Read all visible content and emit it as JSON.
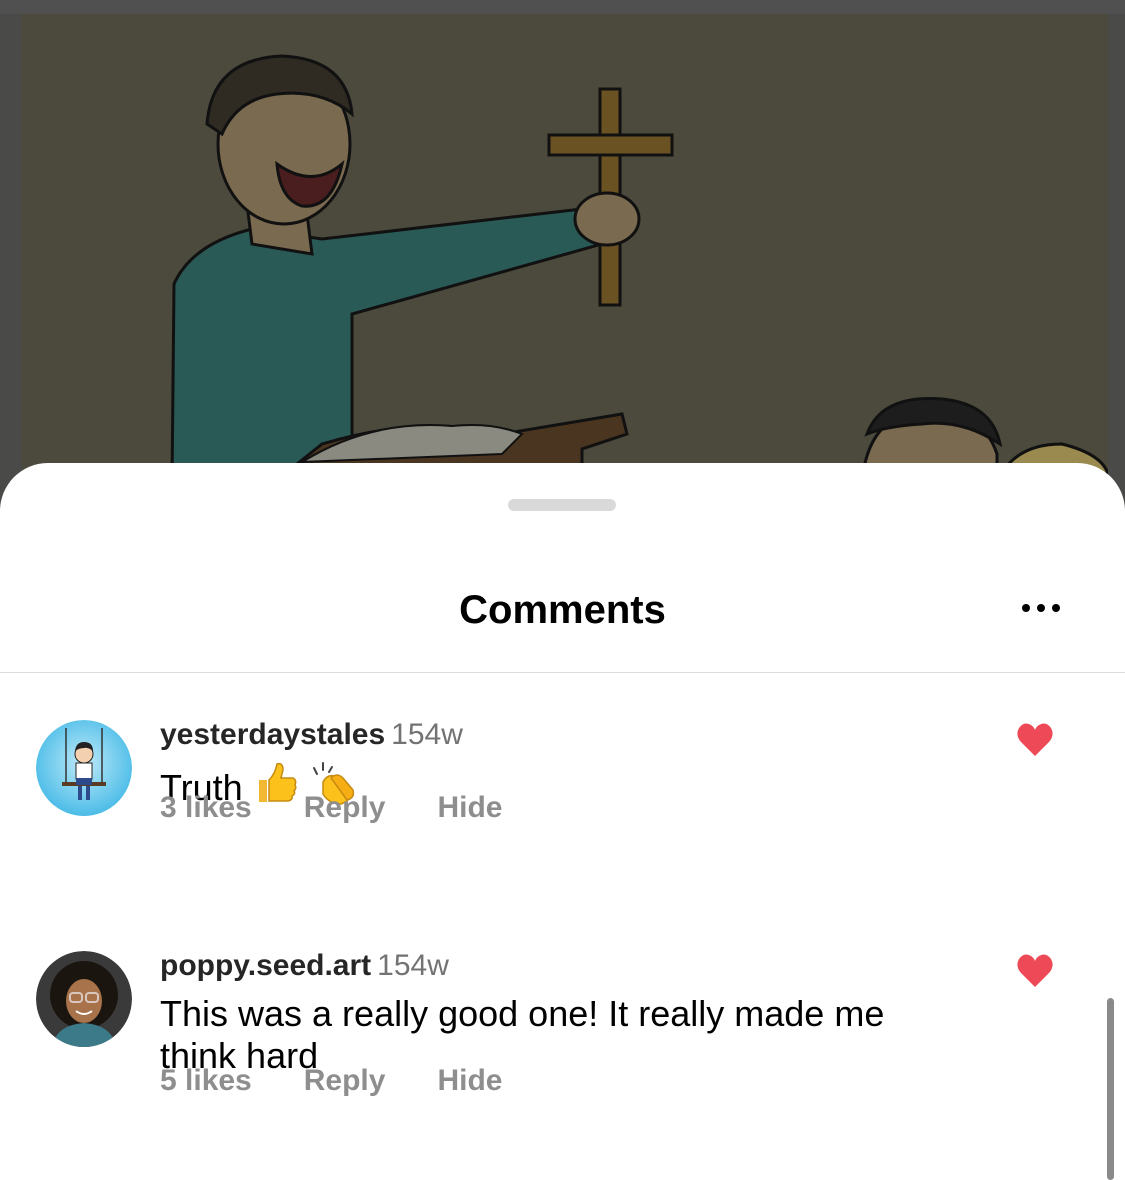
{
  "sheet": {
    "title": "Comments",
    "more_icon": "ellipsis-icon"
  },
  "comments": [
    {
      "username": "yesterdaystales",
      "time": "154w",
      "text": "Truth",
      "emojis": [
        "thumbs-up-emoji",
        "clapping-hands-emoji"
      ],
      "likes": "3 likes",
      "reply_label": "Reply",
      "hide_label": "Hide",
      "liked": true
    },
    {
      "username": "poppy.seed.art",
      "time": "154w",
      "text": "This was a really good one! It really made me think hard",
      "likes": "5 likes",
      "reply_label": "Reply",
      "hide_label": "Hide",
      "liked": true
    }
  ],
  "colors": {
    "heart": "#ed4956",
    "muted": "#8e8e8e",
    "sheet_bg": "#ffffff"
  }
}
